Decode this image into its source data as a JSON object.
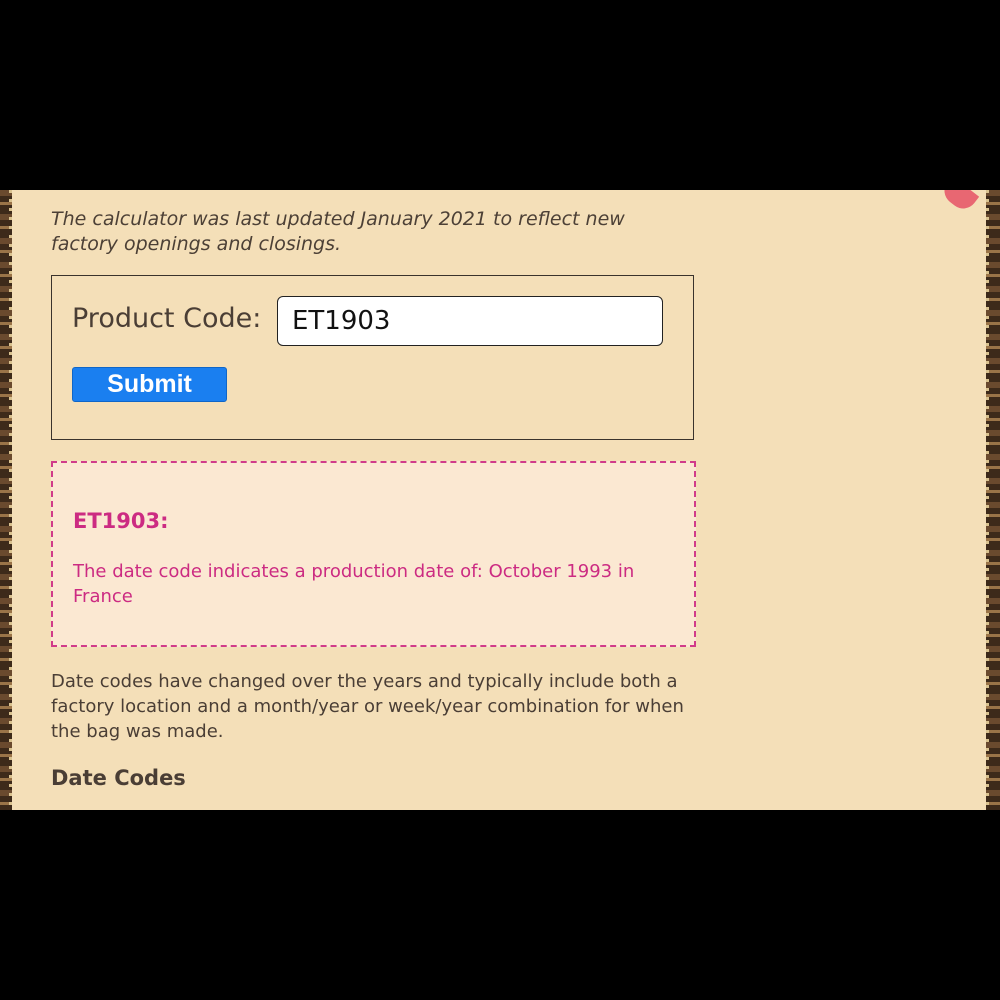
{
  "intro_note": "The calculator was last updated January 2021 to reflect new factory openings and closings.",
  "calculator": {
    "label": "Product Code:",
    "input_value": "ET1903",
    "submit_label": "Submit"
  },
  "result": {
    "code": "ET1903:",
    "message": "The date code indicates a production date of: October 1993 in France"
  },
  "description": "Date codes have changed over the years and typically include both a factory location and a month/year or week/year combination for when the bag was made.",
  "section_heading": "Date Codes",
  "colors": {
    "background": "#f4dfb8",
    "accent": "#1a7ff0",
    "result_text": "#cc2b82",
    "result_border": "#d13b8a"
  },
  "icons": [
    "ribbon-decoration"
  ]
}
